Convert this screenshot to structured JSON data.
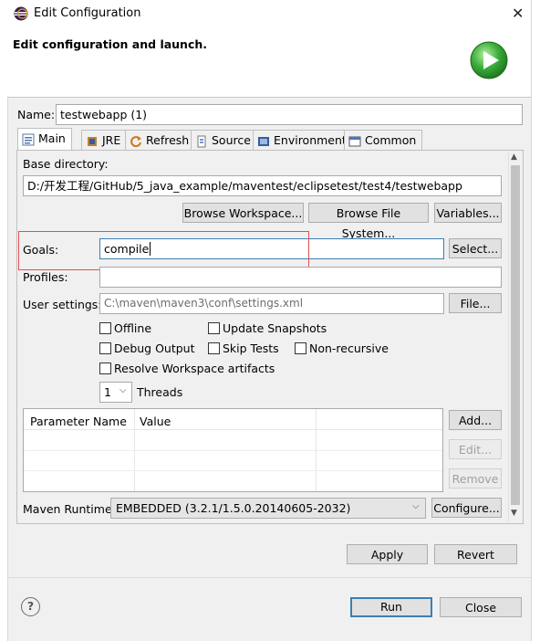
{
  "window": {
    "title": "Edit Configuration",
    "close_glyph": "✕",
    "app_icon": "eclipse-icon"
  },
  "banner": {
    "heading": "Edit configuration and launch.",
    "icon": "run-launch-icon",
    "icon_color": "#3cae3c"
  },
  "name_field": {
    "label": "Name:",
    "value": "testwebapp (1)"
  },
  "tabs": [
    {
      "label": "Main",
      "icon": "main-tab-icon",
      "active": true
    },
    {
      "label": "JRE",
      "icon": "jre-icon"
    },
    {
      "label": "Refresh",
      "icon": "refresh-icon"
    },
    {
      "label": "Source",
      "icon": "source-icon"
    },
    {
      "label": "Environment",
      "icon": "environment-icon"
    },
    {
      "label": "Common",
      "icon": "common-icon"
    }
  ],
  "main": {
    "base_directory_label": "Base directory:",
    "base_directory_value": "D:/开发工程/GitHub/5_java_example/maventest/eclipsetest/test4/testwebapp",
    "browse_workspace": "Browse Workspace...",
    "browse_file_system": "Browse File System...",
    "variables": "Variables...",
    "goals_label": "Goals:",
    "goals_value": "compile",
    "select_button": "Select...",
    "profiles_label": "Profiles:",
    "profiles_value": "",
    "user_settings_label": "User settings:",
    "user_settings_value": "C:\\maven\\maven3\\conf\\settings.xml",
    "file_button": "File...",
    "checkboxes": {
      "offline": "Offline",
      "update_snapshots": "Update Snapshots",
      "debug_output": "Debug Output",
      "skip_tests": "Skip Tests",
      "non_recursive": "Non-recursive",
      "resolve_workspace": "Resolve Workspace artifacts"
    },
    "threads_value": "1",
    "threads_label": "Threads",
    "param_table": {
      "columns": [
        "Parameter Name",
        "Value"
      ],
      "rows": []
    },
    "add_button": "Add...",
    "edit_button": "Edit...",
    "remove_button": "Remove",
    "maven_runtime_label": "Maven Runtime:",
    "maven_runtime_value": "EMBEDDED (3.2.1/1.5.0.20140605-2032)",
    "configure_button": "Configure..."
  },
  "footer": {
    "apply": "Apply",
    "revert": "Revert",
    "run": "Run",
    "close": "Close",
    "help_glyph": "?"
  },
  "colors": {
    "highlight_box": "#e05050",
    "run_border": "#3c7fb1"
  }
}
